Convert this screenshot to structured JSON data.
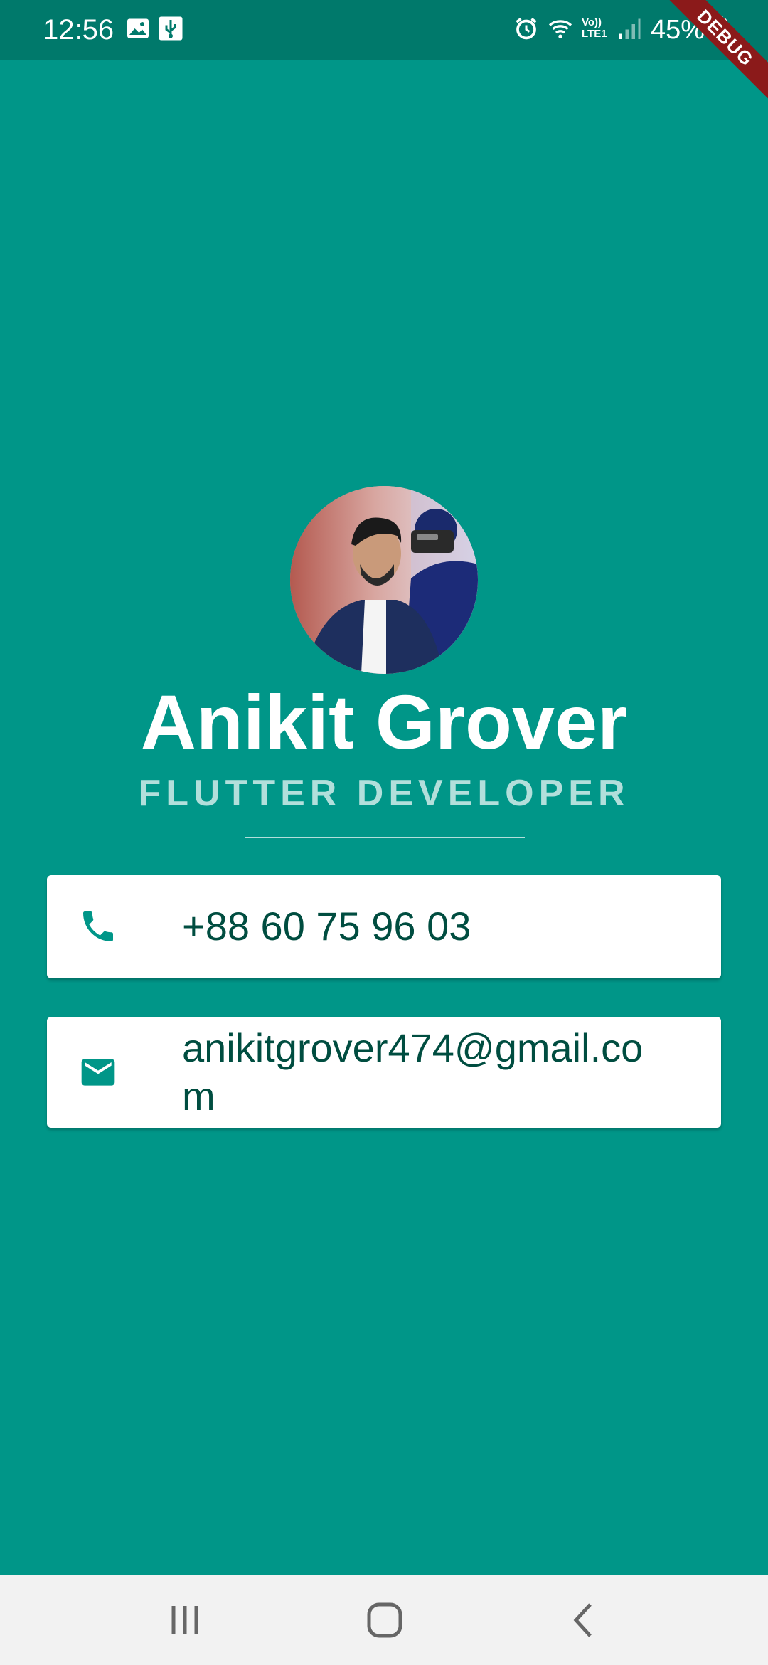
{
  "status_bar": {
    "time": "12:56",
    "battery": "45%",
    "network_label": "Vo)) LTE1",
    "icons": [
      "gallery-icon",
      "usb-icon",
      "alarm-icon",
      "wifi-icon",
      "signal-icon",
      "battery-icon"
    ]
  },
  "debug_banner": "DEBUG",
  "profile": {
    "name": "Anikit Grover",
    "title": "FLUTTER DEVELOPER"
  },
  "contact": {
    "phone": "+88 60 75 96 03",
    "email": "anikitgrover474@gmail.com",
    "phone_icon": "phone-icon",
    "email_icon": "mail-icon"
  },
  "colors": {
    "background": "#009688",
    "status_bar": "#00796B",
    "card_text": "#004D40",
    "subtitle": "#B2DFDB",
    "icon": "#009688"
  },
  "nav_bar": {
    "buttons": [
      "recent-apps-button",
      "home-button",
      "back-button"
    ]
  }
}
